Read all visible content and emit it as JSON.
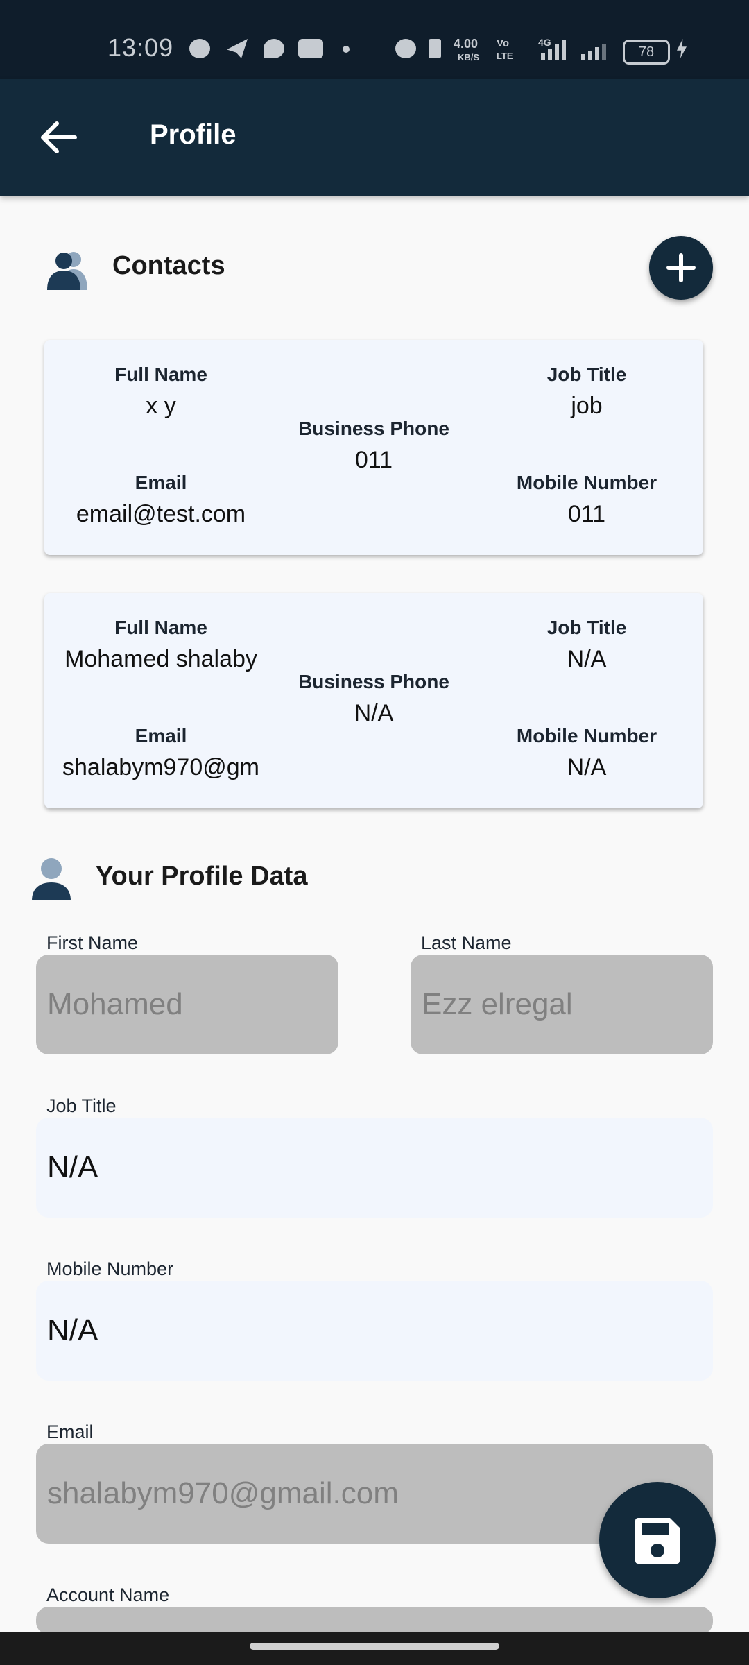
{
  "status_bar": {
    "time": "13:09",
    "net_speed_value": "4.00",
    "net_speed_unit": "KB/S",
    "volte_top": "Vo",
    "volte_bottom": "LTE",
    "network_type": "4G",
    "battery": "78",
    "icons": [
      "whatsapp-icon",
      "telegram-icon",
      "chat-icon",
      "youtube-icon",
      "alarm-icon",
      "bluetooth-icon",
      "signal-icon",
      "charging-icon"
    ]
  },
  "app_bar": {
    "title": "Profile",
    "back_icon": "arrow-left-icon",
    "background": "#132a3b"
  },
  "contacts": {
    "title": "Contacts",
    "labels": {
      "full_name": "Full Name",
      "job_title": "Job Title",
      "business_phone": "Business Phone",
      "email": "Email",
      "mobile_number": "Mobile Number"
    },
    "items": [
      {
        "full_name": "x y",
        "job_title": "job",
        "business_phone": "011",
        "email": "email@test.com",
        "mobile_number": "011"
      },
      {
        "full_name": "Mohamed shalaby",
        "job_title": "N/A",
        "business_phone": "N/A",
        "email": "shalabym970@gm",
        "mobile_number": "N/A"
      }
    ]
  },
  "profile": {
    "title": "Your Profile Data",
    "first_name": {
      "label": "First Name",
      "value": "Mohamed"
    },
    "last_name": {
      "label": "Last Name",
      "value": "Ezz elregal"
    },
    "job_title": {
      "label": "Job Title",
      "value": "N/A"
    },
    "mobile_number": {
      "label": "Mobile Number",
      "value": "N/A"
    },
    "email": {
      "label": "Email",
      "value": "shalabym970@gmail.com"
    },
    "account_name": {
      "label": "Account Name",
      "value": ""
    }
  },
  "colors": {
    "primary": "#132a3b",
    "disabled_field": "#bdbdbd",
    "editable_field": "#f2f6fd",
    "card": "#f2f6fd"
  }
}
